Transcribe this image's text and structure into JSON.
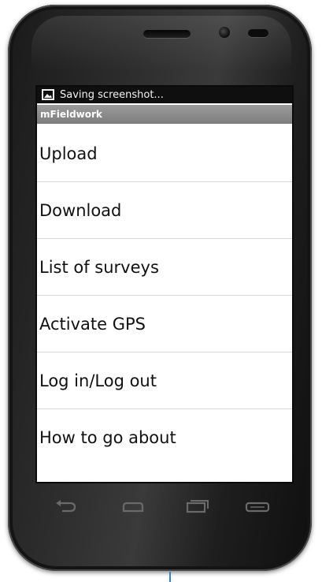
{
  "status_bar": {
    "icon": "image-icon",
    "text": "Saving screenshot..."
  },
  "app": {
    "title": "mFieldwork"
  },
  "menu": {
    "items": [
      {
        "label": "Upload"
      },
      {
        "label": "Download"
      },
      {
        "label": "List of surveys"
      },
      {
        "label": "Activate GPS"
      },
      {
        "label": "Log in/Log out"
      },
      {
        "label": "How to go about"
      }
    ]
  },
  "nav_buttons": [
    {
      "icon": "back-icon"
    },
    {
      "icon": "home-icon"
    },
    {
      "icon": "recent-apps-icon"
    },
    {
      "icon": "menu-icon"
    }
  ],
  "colors": {
    "status_bar_bg": "#0f0f0f",
    "title_bar_bg": "#8a8a8a",
    "screen_bg": "#ffffff",
    "phone_body": "#1e1e1e"
  }
}
